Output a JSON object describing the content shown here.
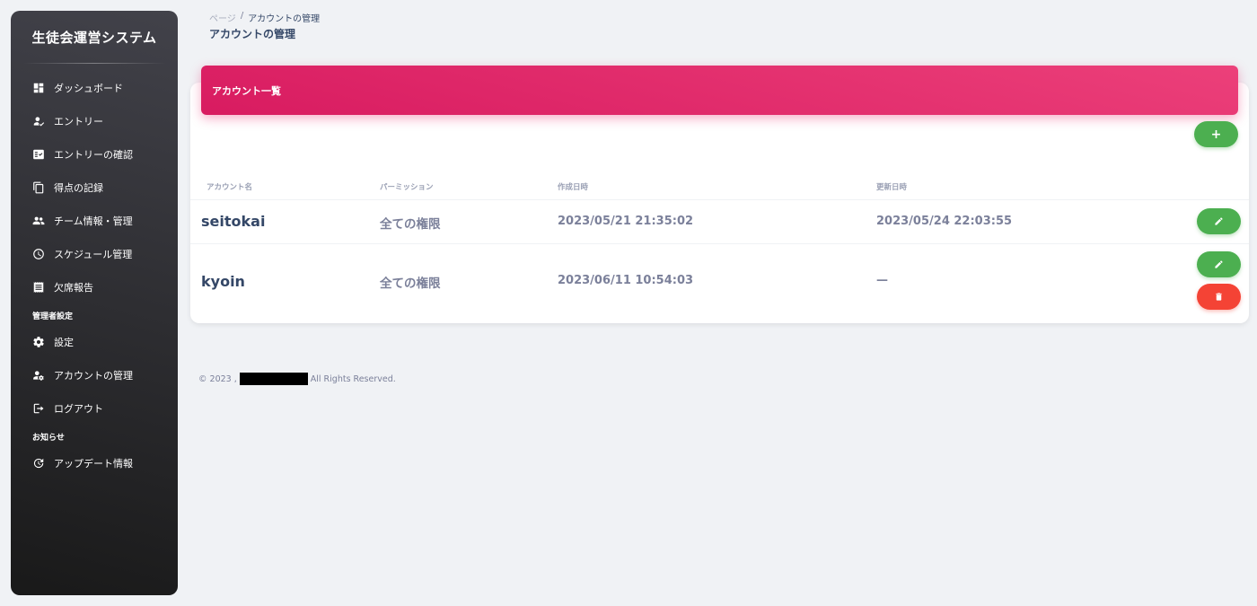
{
  "sidebar": {
    "brand": "生徒会運営システム",
    "items": [
      {
        "label": "ダッシュボード",
        "icon": "dashboard-icon"
      },
      {
        "label": "エントリー",
        "icon": "person-check-icon"
      },
      {
        "label": "エントリーの確認",
        "icon": "fact-check-icon"
      },
      {
        "label": "得点の記録",
        "icon": "copy-icon"
      },
      {
        "label": "チーム情報・管理",
        "icon": "group-icon"
      },
      {
        "label": "スケジュール管理",
        "icon": "clock-icon"
      },
      {
        "label": "欠席報告",
        "icon": "receipt-icon"
      }
    ],
    "admin_section": "管理者設定",
    "admin_items": [
      {
        "label": "設定",
        "icon": "gear-icon"
      },
      {
        "label": "アカウントの管理",
        "icon": "manage-accounts-icon"
      },
      {
        "label": "ログアウト",
        "icon": "logout-icon"
      }
    ],
    "news_section": "お知らせ",
    "news_items": [
      {
        "label": "アップデート情報",
        "icon": "update-icon"
      }
    ]
  },
  "header": {
    "breadcrumb_root": "ページ",
    "breadcrumb_sep": "/",
    "breadcrumb_current": "アカウントの管理",
    "title": "アカウントの管理"
  },
  "card": {
    "title": "アカウント一覧",
    "add_label": "+",
    "columns": [
      "アカウント名",
      "パーミッション",
      "作成日時",
      "更新日時"
    ],
    "rows": [
      {
        "name": "seitokai",
        "permission": "全ての権限",
        "created": "2023/05/21 21:35:02",
        "updated": "2023/05/24 22:03:55"
      },
      {
        "name": "kyoin",
        "permission": "全ての権限",
        "created": "2023/06/11 10:54:03",
        "updated": "—"
      }
    ]
  },
  "footer": {
    "copyright": "© 2023 ,",
    "rights": "All Rights Reserved."
  },
  "colors": {
    "header_gradient_start": "#ec407a",
    "header_gradient_end": "#d81b60",
    "edit_button": "#4caf50",
    "delete_button": "#f44335",
    "sidebar_dark": "#191919"
  }
}
